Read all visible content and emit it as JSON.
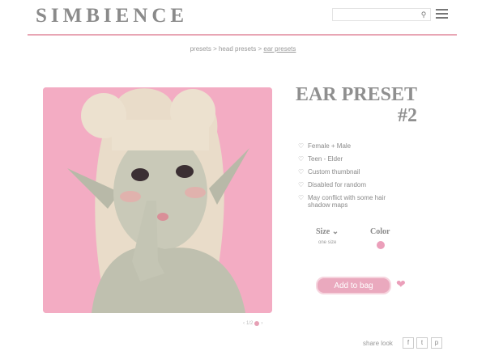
{
  "header": {
    "logo": "SIMBIENCE",
    "search_placeholder": "",
    "search_icon": "search-icon",
    "menu_icon": "hamburger-menu-icon",
    "accent_color": "#e8a6b4"
  },
  "breadcrumb": {
    "items": [
      "presets",
      "head presets",
      "ear presets"
    ],
    "separator": ">"
  },
  "product": {
    "title_line1": "EAR PRESET",
    "title_line2": "#2",
    "features": [
      "Female + Male",
      "Teen - Elder",
      "Custom thumbnail",
      "Disabled for random",
      "May conflict with some hair shadow maps"
    ],
    "size_label": "Size",
    "size_value": "one size",
    "color_label": "Color",
    "swatch_color": "#eb9fba",
    "add_to_bag": "Add to bag",
    "gallery": {
      "indicator": "< 1/2 >",
      "bg_color": "#f3acc3"
    }
  },
  "footer": {
    "share_label": "share look",
    "social": [
      "f",
      "t",
      "p"
    ]
  }
}
